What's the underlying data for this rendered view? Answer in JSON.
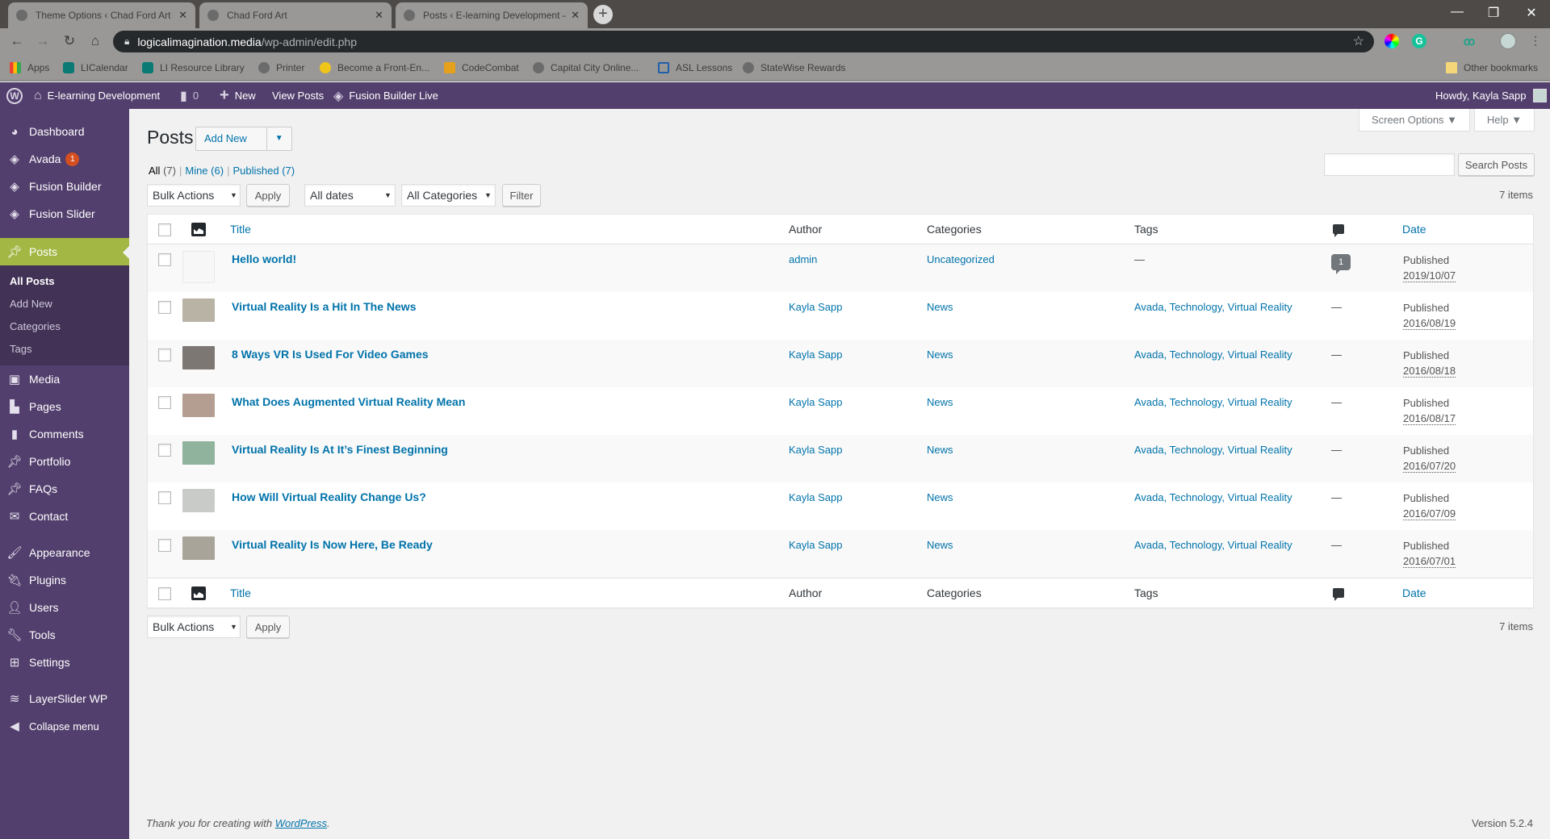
{
  "browser": {
    "tabs": [
      {
        "title": "Theme Options ‹ Chad Ford Art –",
        "active": false
      },
      {
        "title": "Chad Ford Art",
        "active": false
      },
      {
        "title": "Posts ‹ E-learning Development –",
        "active": true
      }
    ],
    "url_host": "logicalimagination.media",
    "url_path": "/wp-admin/edit.php",
    "bookmarks": [
      {
        "label": "Apps",
        "icon": "apps-grid-icon"
      },
      {
        "label": "LICalendar",
        "icon": "sharepoint-icon"
      },
      {
        "label": "LI Resource Library",
        "icon": "sharepoint-icon"
      },
      {
        "label": "Printer",
        "icon": "globe-icon"
      },
      {
        "label": "Become a Front-En...",
        "icon": "penguin-icon"
      },
      {
        "label": "CodeCombat",
        "icon": "codecombat-icon"
      },
      {
        "label": "Capital City Online...",
        "icon": "globe-icon"
      },
      {
        "label": "ASL Lessons",
        "icon": "asl-icon"
      },
      {
        "label": "StateWise Rewards",
        "icon": "globe-icon"
      }
    ],
    "other_bookmarks": "Other bookmarks"
  },
  "adminbar": {
    "site_name": "E-learning Development",
    "comments_count": "0",
    "new_label": "New",
    "view_posts": "View Posts",
    "fusion_live": "Fusion Builder Live",
    "howdy": "Howdy, Kayla Sapp"
  },
  "sidebar": {
    "items": [
      {
        "label": "Dashboard",
        "icon": "dashboard-icon"
      },
      {
        "label": "Avada",
        "icon": "avada-icon",
        "badge": "1"
      },
      {
        "label": "Fusion Builder",
        "icon": "avada-icon"
      },
      {
        "label": "Fusion Slider",
        "icon": "avada-icon"
      },
      {
        "label": "Posts",
        "icon": "pin-icon",
        "current": true
      },
      {
        "label": "Media",
        "icon": "media-icon"
      },
      {
        "label": "Pages",
        "icon": "pages-icon"
      },
      {
        "label": "Comments",
        "icon": "comment-icon"
      },
      {
        "label": "Portfolio",
        "icon": "pin-icon"
      },
      {
        "label": "FAQs",
        "icon": "pin-icon"
      },
      {
        "label": "Contact",
        "icon": "mail-icon"
      },
      {
        "label": "Appearance",
        "icon": "brush-icon"
      },
      {
        "label": "Plugins",
        "icon": "plug-icon"
      },
      {
        "label": "Users",
        "icon": "user-icon"
      },
      {
        "label": "Tools",
        "icon": "wrench-icon"
      },
      {
        "label": "Settings",
        "icon": "settings-icon"
      },
      {
        "label": "LayerSlider WP",
        "icon": "layers-icon"
      },
      {
        "label": "Collapse menu",
        "icon": "collapse-icon"
      }
    ],
    "submenu": [
      "All Posts",
      "Add New",
      "Categories",
      "Tags"
    ]
  },
  "screen_meta": {
    "screen_options": "Screen Options ▼",
    "help": "Help ▼"
  },
  "page": {
    "title": "Posts",
    "add_new": "Add New",
    "views": [
      {
        "label": "All",
        "count": "(7)"
      },
      {
        "label": "Mine",
        "count": "(6)"
      },
      {
        "label": "Published",
        "count": "(7)"
      }
    ],
    "bulk_actions": "Bulk Actions",
    "apply": "Apply",
    "all_dates": "All dates",
    "all_categories": "All Categories",
    "filter": "Filter",
    "search_button": "Search Posts",
    "search_value": "",
    "items_count": "7 items"
  },
  "table": {
    "columns": {
      "title": "Title",
      "author": "Author",
      "categories": "Categories",
      "tags": "Tags",
      "date": "Date"
    },
    "rows": [
      {
        "title": "Hello world!",
        "author": "admin",
        "categories": "Uncategorized",
        "tags": "—",
        "comments": "1",
        "status": "Published",
        "date": "2019/10/07",
        "thumb_color": ""
      },
      {
        "title": "Virtual Reality Is a Hit In The News",
        "author": "Kayla Sapp",
        "categories": "News",
        "tags": "Avada, Technology, Virtual Reality",
        "comments": "—",
        "status": "Published",
        "date": "2016/08/19",
        "thumb_color": "#b9b3a6"
      },
      {
        "title": "8 Ways VR Is Used For Video Games",
        "author": "Kayla Sapp",
        "categories": "News",
        "tags": "Avada, Technology, Virtual Reality",
        "comments": "—",
        "status": "Published",
        "date": "2016/08/18",
        "thumb_color": "#7d7774"
      },
      {
        "title": "What Does Augmented Virtual Reality Mean",
        "author": "Kayla Sapp",
        "categories": "News",
        "tags": "Avada, Technology, Virtual Reality",
        "comments": "—",
        "status": "Published",
        "date": "2016/08/17",
        "thumb_color": "#b49e91"
      },
      {
        "title": "Virtual Reality Is At It’s Finest Beginning",
        "author": "Kayla Sapp",
        "categories": "News",
        "tags": "Avada, Technology, Virtual Reality",
        "comments": "—",
        "status": "Published",
        "date": "2016/07/20",
        "thumb_color": "#8fb39c"
      },
      {
        "title": "How Will Virtual Reality Change Us?",
        "author": "Kayla Sapp",
        "categories": "News",
        "tags": "Avada, Technology, Virtual Reality",
        "comments": "—",
        "status": "Published",
        "date": "2016/07/09",
        "thumb_color": "#c9cbc9"
      },
      {
        "title": "Virtual Reality Is Now Here, Be Ready",
        "author": "Kayla Sapp",
        "categories": "News",
        "tags": "Avada, Technology, Virtual Reality",
        "comments": "—",
        "status": "Published",
        "date": "2016/07/01",
        "thumb_color": "#a9a49a"
      }
    ]
  },
  "footer": {
    "thanks_prefix": "Thank you for creating with ",
    "wordpress_link": "WordPress",
    "thanks_suffix": ".",
    "version": "Version 5.2.4"
  },
  "colors": {
    "admin_purple": "#523f6d",
    "submenu_purple": "#413256",
    "accent_green": "#a3b745",
    "link_blue": "#0073aa",
    "badge_orange": "#d54e21"
  }
}
